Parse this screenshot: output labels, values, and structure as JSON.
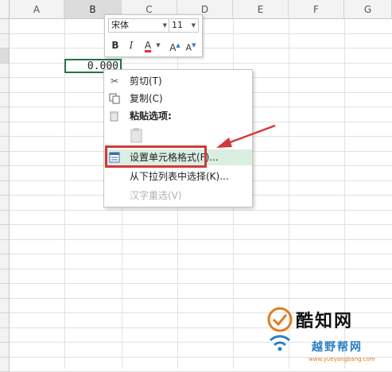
{
  "sheet": {
    "columns": [
      "A",
      "B",
      "C",
      "D",
      "E",
      "F",
      "G"
    ],
    "selected_column": "B",
    "active_cell_value": "0.000"
  },
  "mini_toolbar": {
    "font_name": "宋体",
    "font_size": "11",
    "bold": "B",
    "italic": "I",
    "font_color": "A",
    "grow_font": "A",
    "shrink_font": "A",
    "font_color_swatch": "#e03030"
  },
  "context_menu": {
    "items": [
      {
        "label": "剪切(T)",
        "icon": "scissors-icon",
        "enabled": true
      },
      {
        "label": "复制(C)",
        "icon": "copy-icon",
        "enabled": true
      },
      {
        "label": "粘贴选项:",
        "icon": "paste-icon",
        "enabled": true,
        "bold": true
      },
      {
        "label": "设置单元格格式(F)...",
        "icon": "format-cells-icon",
        "enabled": true,
        "highlighted": true
      },
      {
        "label": "从下拉列表中选择(K)...",
        "icon": "",
        "enabled": true
      },
      {
        "label": "汉字重选(V)",
        "icon": "",
        "enabled": false
      }
    ]
  },
  "watermark": {
    "title": "酷知网",
    "subtitle": "越野帮网",
    "url": "www.yueyangbang.com"
  },
  "colors": {
    "highlight": "#dbeee2",
    "annotation": "#d23a3a",
    "active_cell_border": "#217346"
  }
}
